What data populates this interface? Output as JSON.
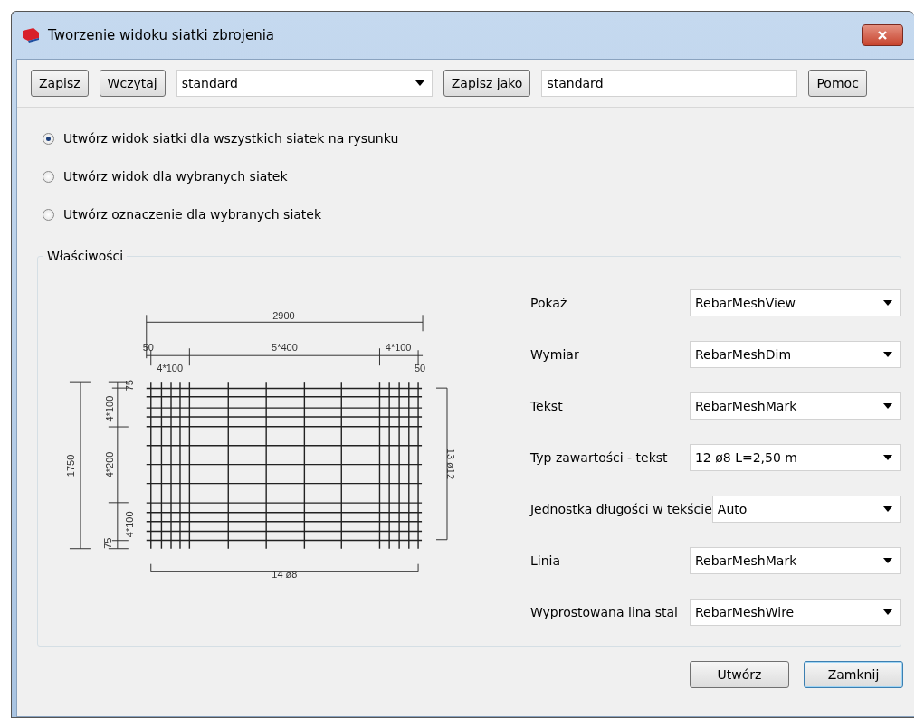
{
  "window": {
    "title": "Tworzenie widoku siatki zbrojenia"
  },
  "toolbar": [
    {
      "kind": "button",
      "label": "Zapisz"
    },
    {
      "kind": "button",
      "label": "Wczytaj"
    },
    {
      "kind": "combo",
      "value": "standard"
    },
    {
      "kind": "button",
      "label": "Zapisz jako"
    },
    {
      "kind": "field",
      "value": "standard"
    },
    {
      "kind": "button",
      "label": "Pomoc"
    }
  ],
  "options": [
    {
      "label": "Utwórz widok siatki dla wszystkich siatek na rysunku",
      "selected": true
    },
    {
      "label": "Utwórz widok dla wybranych siatek",
      "selected": false
    },
    {
      "label": "Utwórz oznaczenie dla wybranych siatek",
      "selected": false
    }
  ],
  "properties": {
    "legend": "Właściwości",
    "drawing_labels": [
      "2900",
      "50",
      "5*400",
      "4*100",
      "4*100",
      "50",
      "75",
      "4*100",
      "4*200",
      "4*100",
      "75",
      "1750",
      "13 ø12",
      "14 ø8"
    ],
    "fields": [
      {
        "label": "Pokaż",
        "value": "RebarMeshView"
      },
      {
        "label": "Wymiar",
        "value": "RebarMeshDim"
      },
      {
        "label": "Tekst",
        "value": "RebarMeshMark"
      },
      {
        "label": "Typ zawartości - tekst",
        "value": "12 ø8 L=2,50 m"
      },
      {
        "label": "Jednostka długości w tekście",
        "value": "Auto"
      },
      {
        "label": "Linia",
        "value": "RebarMeshMark"
      },
      {
        "label": "Wyprostowana lina stal",
        "value": "RebarMeshWire"
      }
    ]
  },
  "buttons": [
    "Utwórz",
    "Zamknij"
  ]
}
